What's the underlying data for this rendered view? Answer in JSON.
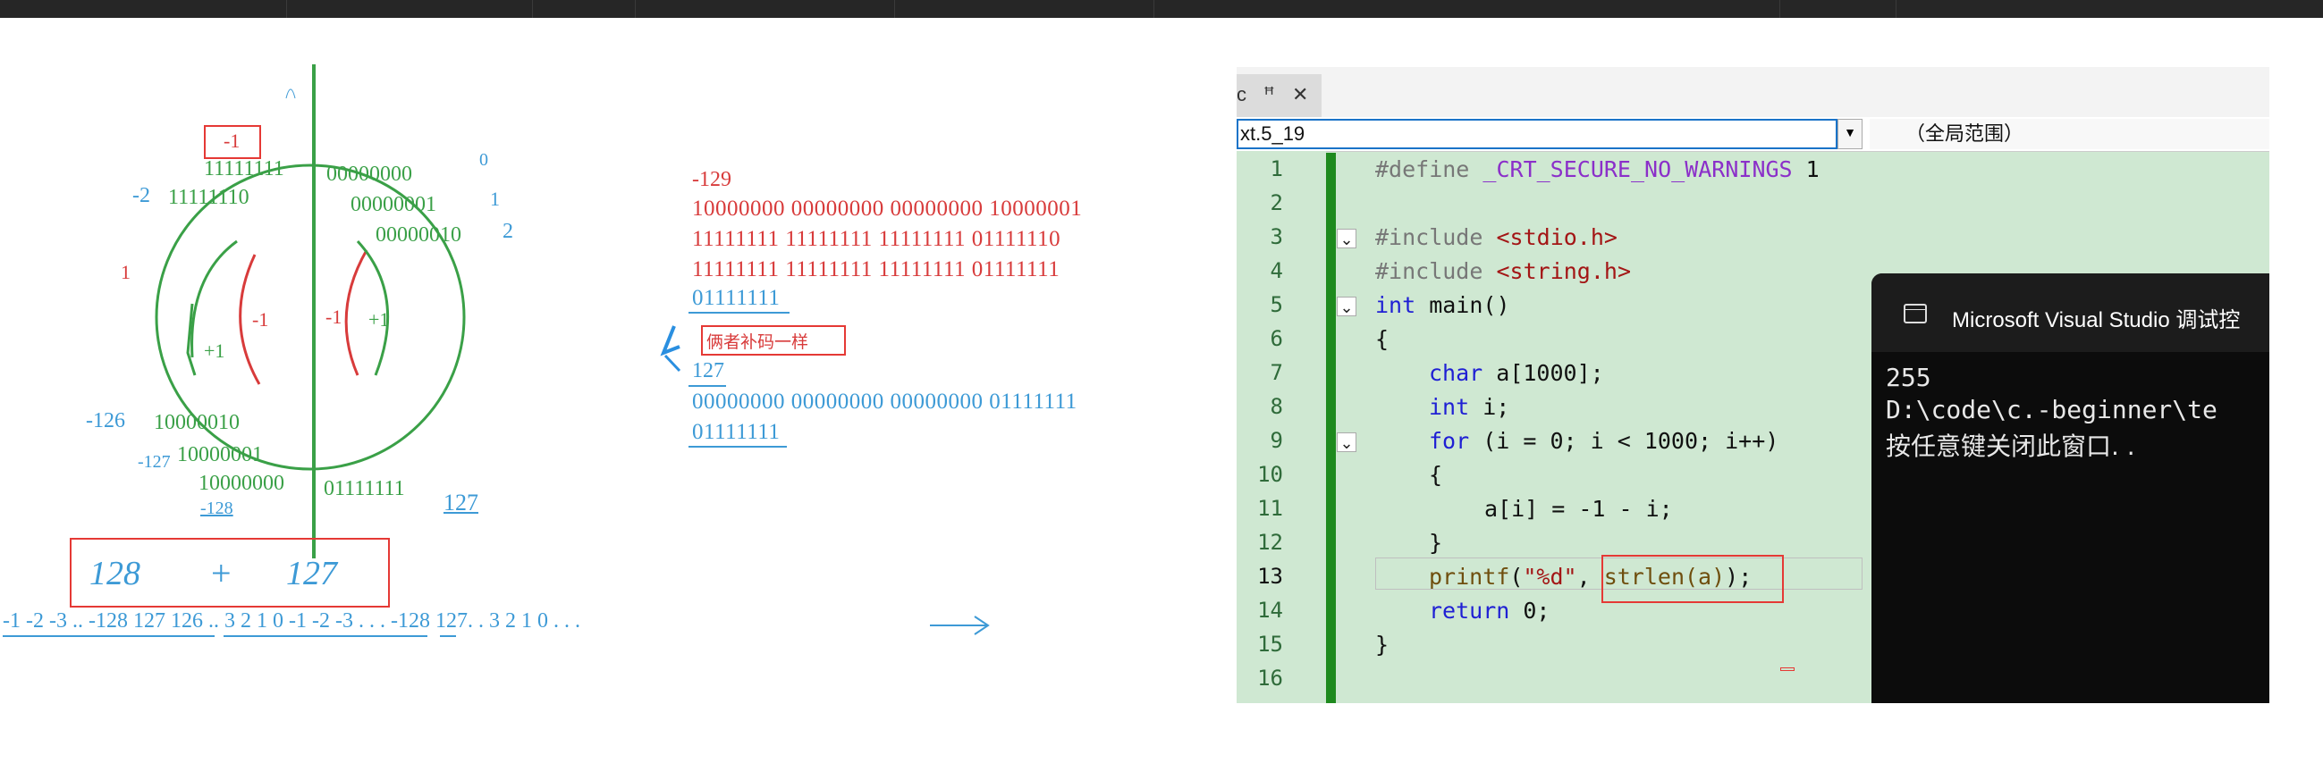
{
  "window": {
    "file_name": "xt.5_19",
    "scope": "（全局范围）",
    "tab_pin": "ꟸ",
    "tab_close": "✕"
  },
  "whiteboard": {
    "circle_labels": {
      "neg1_boxed": "-1",
      "top": "11111111",
      "zero": "00000000",
      "one": "00000001",
      "two_bin": "00000010",
      "neg2_bin": "11111110",
      "neg2": "-2",
      "one_dec": "1",
      "two_dec": "2",
      "zero_dec": "0",
      "neg126": "-126",
      "neg126_bin": "10000010",
      "neg127": "-127",
      "neg127_bin": "10000001",
      "neg128_bin": "10000000",
      "neg128": "-128",
      "pos127_bin": "01111111",
      "pos127": "127",
      "arrow_plus_left": "+1",
      "arrow_minus_left": "-1",
      "arrow_minus_right": "-1",
      "arrow_plus_right": "+1",
      "left_tick": "1"
    },
    "sum_box": {
      "left": "128",
      "op": "+",
      "right": "127"
    },
    "sequence": "-1  -2 -3 ..  -128  127  126 ..  3  2  1   0  -1  -2  -3  . . .   -128  127. .  3  2  1  0  . . .",
    "bits": {
      "label_neg129": "-129",
      "original": "10000000 00000000 00000000 10000001",
      "ones_complement": "11111111 11111111 11111111 01111110",
      "twos_complement": "11111111 11111111 11111111 01111111",
      "truncated": "01111111",
      "note": "俩者补码一样",
      "value_127": "127",
      "pos127_full": "00000000 00000000 00000000 01111111",
      "pos127_trunc": "01111111"
    }
  },
  "code": {
    "lines": [
      {
        "n": "1"
      },
      {
        "n": "2"
      },
      {
        "n": "3"
      },
      {
        "n": "4"
      },
      {
        "n": "5"
      },
      {
        "n": "6"
      },
      {
        "n": "7"
      },
      {
        "n": "8"
      },
      {
        "n": "9"
      },
      {
        "n": "10"
      },
      {
        "n": "11"
      },
      {
        "n": "12"
      },
      {
        "n": "13"
      },
      {
        "n": "14"
      },
      {
        "n": "15"
      },
      {
        "n": "16"
      }
    ],
    "l1": {
      "pp": "#define",
      "mac": "_CRT_SECURE_NO_WARNINGS",
      "rest": " 1"
    },
    "l3": {
      "pp": "#include",
      "hdr": "<stdio.h>"
    },
    "l4": {
      "pp": "#include",
      "hdr": "<string.h>"
    },
    "l5": {
      "kw": "int",
      "rest": " main()"
    },
    "l6": "{",
    "l7": {
      "kw": "char",
      "rest": " a[1000];"
    },
    "l8": {
      "kw": "int",
      "rest": " i;"
    },
    "l9": {
      "kw": "for",
      "rest": " (i = 0; i < 1000; i++)"
    },
    "l10": "{",
    "l11": "a[i] = -1 - i;",
    "l12": "}",
    "l13": {
      "fn": "printf",
      "open": "(",
      "str": "\"%d\"",
      "mid": ", ",
      "call": "strlen(a)",
      "close": ");"
    },
    "l14": {
      "kw": "return",
      "rest": " 0;"
    },
    "l15": "}"
  },
  "console": {
    "title": "Microsoft Visual Studio 调试控",
    "output_line1": "255",
    "output_line2": "D:\\code\\c.-beginner\\te",
    "output_line3": "按任意键关闭此窗口. ."
  }
}
